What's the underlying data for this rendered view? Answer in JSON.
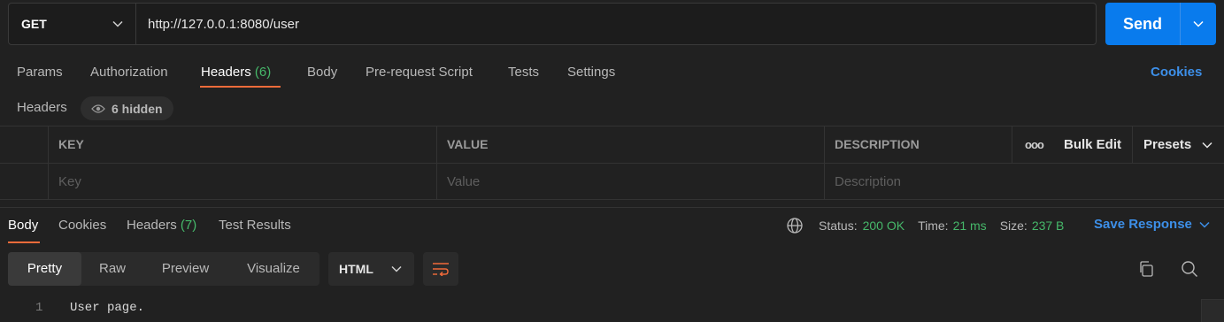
{
  "request": {
    "method": "GET",
    "url": "http://127.0.0.1:8080/user",
    "send_label": "Send"
  },
  "request_tabs": {
    "params": "Params",
    "authorization": "Authorization",
    "headers": "Headers",
    "headers_count": "(6)",
    "body": "Body",
    "prerequest": "Pre-request Script",
    "tests": "Tests",
    "settings": "Settings",
    "cookies": "Cookies"
  },
  "headers_section": {
    "label": "Headers",
    "hidden": "6 hidden"
  },
  "table": {
    "columns": {
      "key": "KEY",
      "value": "VALUE",
      "description": "DESCRIPTION"
    },
    "more": "ooo",
    "bulk_edit": "Bulk Edit",
    "presets": "Presets",
    "placeholders": {
      "key": "Key",
      "value": "Value",
      "description": "Description"
    }
  },
  "response_tabs": {
    "body": "Body",
    "cookies": "Cookies",
    "headers": "Headers",
    "headers_count": "(7)",
    "test_results": "Test Results"
  },
  "status": {
    "status_label": "Status:",
    "status_value": "200 OK",
    "time_label": "Time:",
    "time_value": "21 ms",
    "size_label": "Size:",
    "size_value": "237 B",
    "save_response": "Save Response"
  },
  "view_modes": [
    "Pretty",
    "Raw",
    "Preview",
    "Visualize"
  ],
  "format": "HTML",
  "code": {
    "line_number": "1",
    "line_text": "User page."
  },
  "colors": {
    "accent": "#097bed",
    "tab_underline": "#f26b3a",
    "success": "#46b86a",
    "link": "#3d8fe8"
  }
}
